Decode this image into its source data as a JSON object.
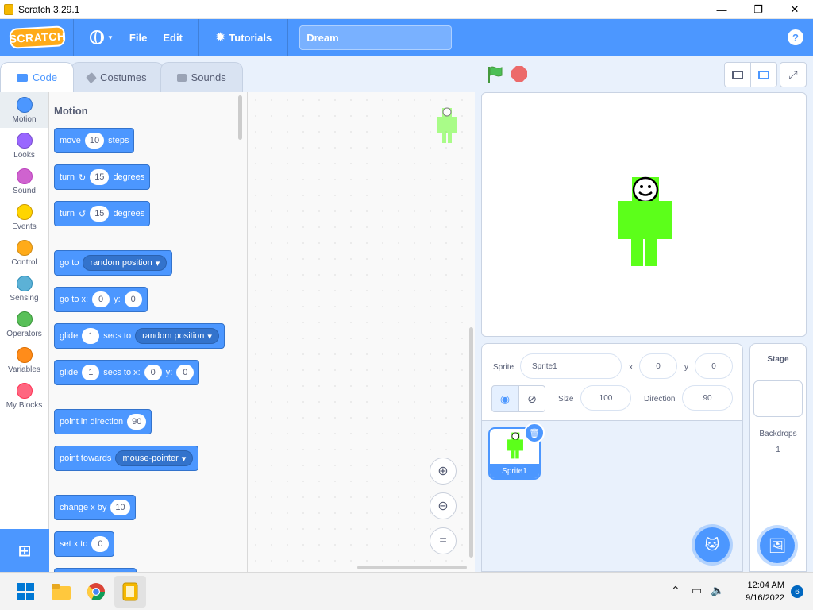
{
  "window": {
    "title": "Scratch 3.29.1",
    "minimize": "—",
    "maximize": "❐",
    "close": "✕"
  },
  "menubar": {
    "logo": "SCRATCH",
    "file": "File",
    "edit": "Edit",
    "tutorials": "Tutorials",
    "project_title": "Dream",
    "help": "?"
  },
  "tabs": {
    "code": "Code",
    "costumes": "Costumes",
    "sounds": "Sounds"
  },
  "categories": [
    {
      "label": "Motion",
      "color": "#4c97ff"
    },
    {
      "label": "Looks",
      "color": "#9966ff"
    },
    {
      "label": "Sound",
      "color": "#cf63cf"
    },
    {
      "label": "Events",
      "color": "#ffd500"
    },
    {
      "label": "Control",
      "color": "#ffab19"
    },
    {
      "label": "Sensing",
      "color": "#5cb1d6"
    },
    {
      "label": "Operators",
      "color": "#59c059"
    },
    {
      "label": "Variables",
      "color": "#ff8c1a"
    },
    {
      "label": "My Blocks",
      "color": "#ff6680"
    }
  ],
  "palette": {
    "section": "Motion",
    "move": {
      "label": "move",
      "value": "10",
      "suffix": "steps"
    },
    "turn_right": {
      "label": "turn",
      "value": "15",
      "suffix": "degrees"
    },
    "turn_left": {
      "label": "turn",
      "value": "15",
      "suffix": "degrees"
    },
    "goto": {
      "label": "go to",
      "option": "random position"
    },
    "goto_xy": {
      "label": "go to x:",
      "x": "0",
      "ylabel": "y:",
      "y": "0"
    },
    "glide_to": {
      "label": "glide",
      "secs": "1",
      "mid": "secs to",
      "option": "random position"
    },
    "glide_xy": {
      "label": "glide",
      "secs": "1",
      "mid": "secs to x:",
      "x": "0",
      "ylabel": "y:",
      "y": "0"
    },
    "point_dir": {
      "label": "point in direction",
      "value": "90"
    },
    "point_towards": {
      "label": "point towards",
      "option": "mouse-pointer"
    },
    "change_x": {
      "label": "change x by",
      "value": "10"
    },
    "set_x": {
      "label": "set x to",
      "value": "0"
    }
  },
  "sprite_info": {
    "sprite_label": "Sprite",
    "sprite_name": "Sprite1",
    "x_label": "x",
    "x_value": "0",
    "y_label": "y",
    "y_value": "0",
    "size_label": "Size",
    "size_value": "100",
    "direction_label": "Direction",
    "direction_value": "90"
  },
  "sprites": [
    {
      "name": "Sprite1"
    }
  ],
  "stage_panel": {
    "title": "Stage",
    "backdrops_label": "Backdrops",
    "backdrops_count": "1"
  },
  "taskbar": {
    "time": "12:04 AM",
    "date": "9/16/2022",
    "notifications": "6"
  },
  "colors": {
    "accent": "#4c97ff",
    "sprite_green": "#5cff1a"
  }
}
